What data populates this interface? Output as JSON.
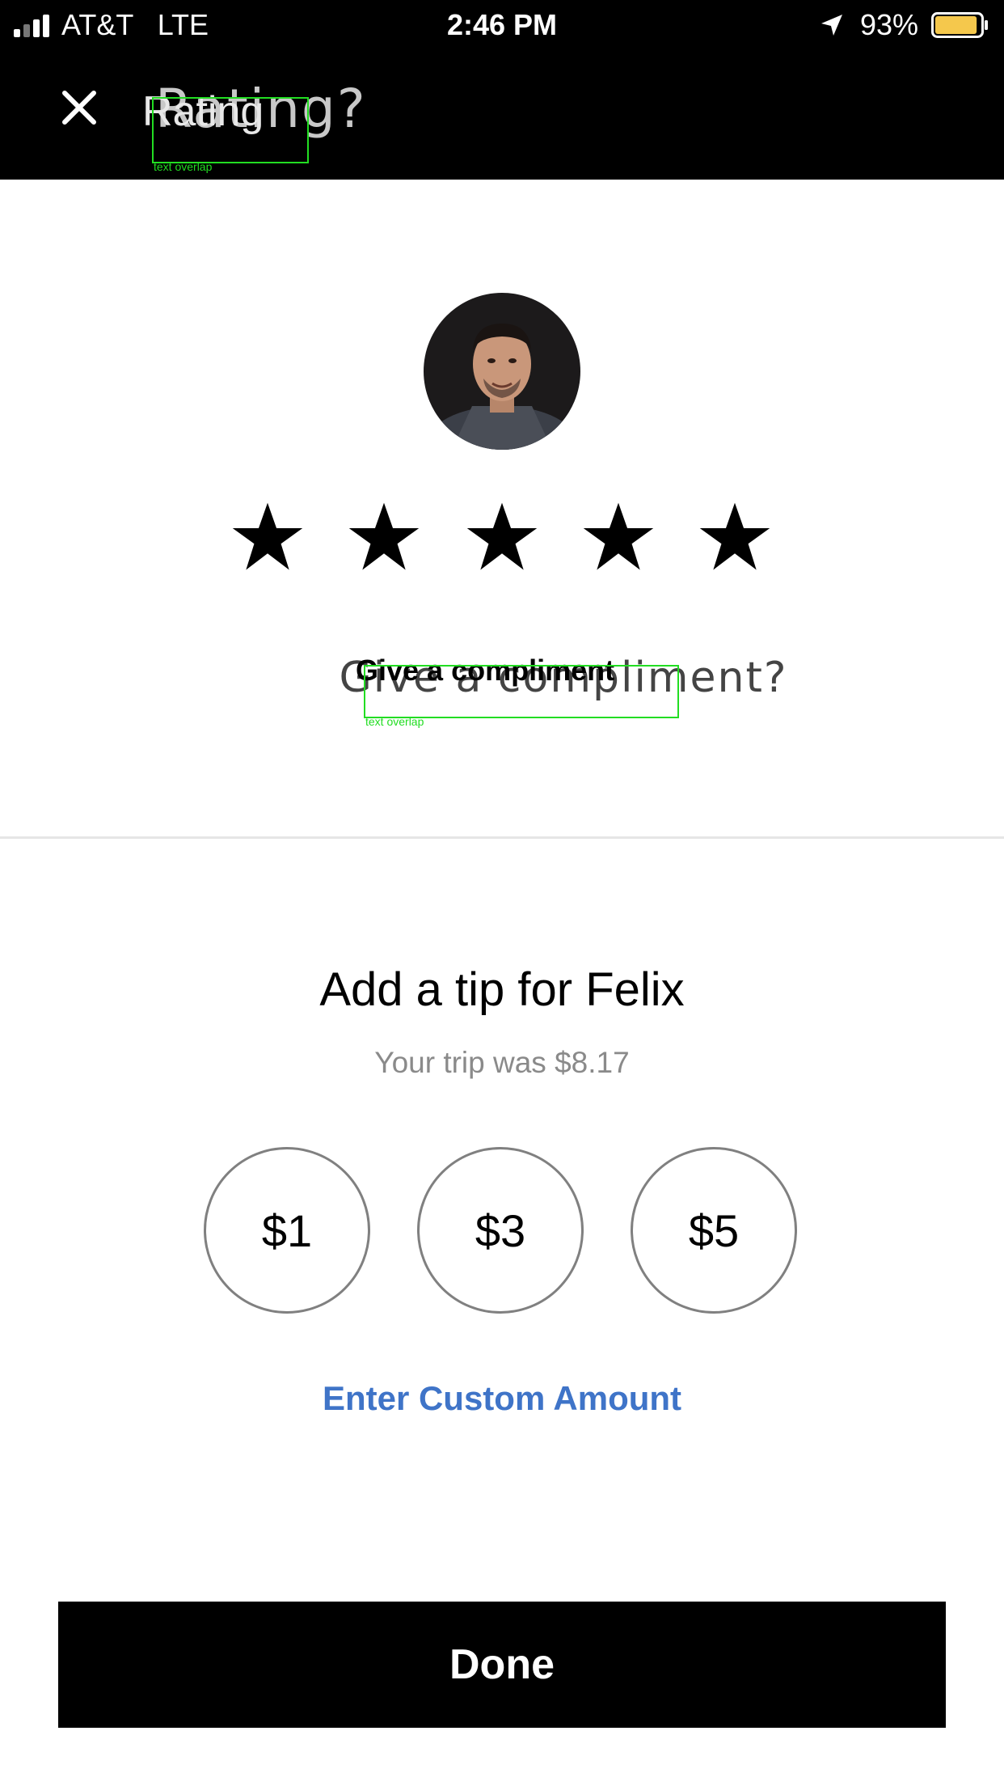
{
  "status_bar": {
    "carrier": "AT&T   LTE",
    "time": "2:46 PM",
    "battery": "93%",
    "battery_color": "#f5c84c",
    "battery_level": 0.93
  },
  "header": {
    "close_icon": "close-icon",
    "title_main": "Rating",
    "title_ghost": "Rating?",
    "overlap_label": "text overlap"
  },
  "driver": {
    "avatar_icon": "driver-photo",
    "rating_stars": 5
  },
  "compliment": {
    "main": "Give a compliment",
    "ghost": "Give a compliment?",
    "overlap_label": "text overlap"
  },
  "tip": {
    "title": "Add a tip for Felix",
    "subtitle": "Your trip was $8.17",
    "options": [
      "$1",
      "$3",
      "$5"
    ],
    "custom_label": "Enter Custom Amount",
    "link_color": "#3f74c8"
  },
  "done_label": "Done"
}
